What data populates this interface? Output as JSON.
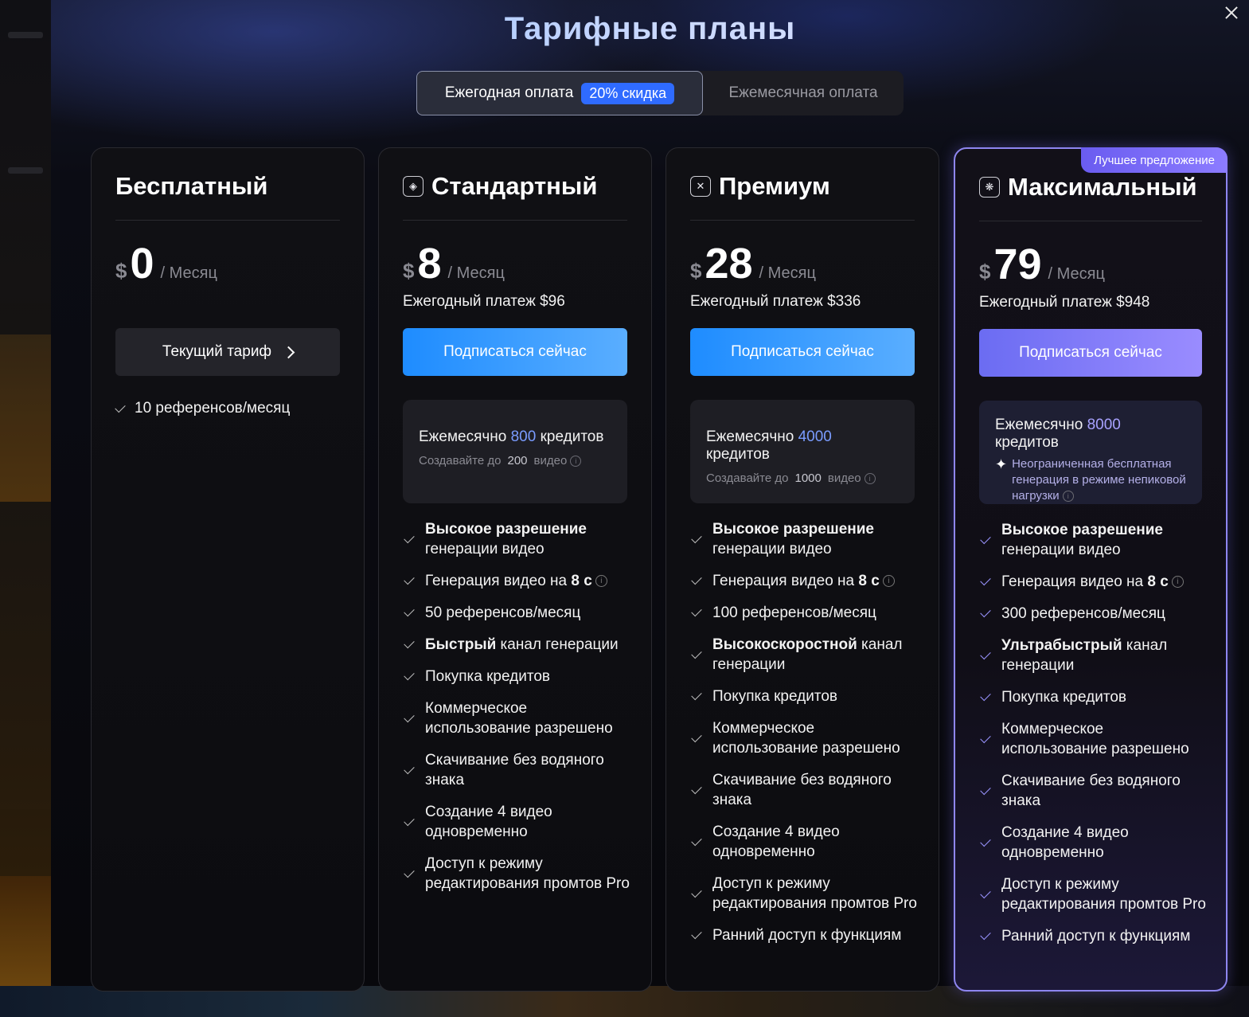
{
  "modal": {
    "title": "Тарифные планы",
    "close_icon": "close-icon"
  },
  "billing_toggle": {
    "annual_label": "Ежегодная оплата",
    "annual_badge": "20% скидка",
    "monthly_label": "Ежемесячная оплата",
    "selected": "annual"
  },
  "plans": {
    "free": {
      "name": "Бесплатный",
      "currency": "$",
      "amount": "0",
      "period": "/ Месяц",
      "button_label": "Текущий тариф",
      "feature": "10 референсов/месяц"
    },
    "standard": {
      "name": "Стандартный",
      "currency": "$",
      "amount": "8",
      "period": "/ Месяц",
      "yearly": "Ежегодный платеж $96",
      "button_label": "Подписаться сейчас",
      "credits_prefix": "Ежемесячно ",
      "credits_num": "800",
      "credits_suffix": " кредитов",
      "sub_prefix": "Создавайте до",
      "sub_num": "200",
      "sub_suffix": "видео",
      "features": [
        {
          "bold": "Высокое разрешение",
          "text": " генерации видео"
        },
        {
          "text": "Генерация видео на ",
          "bold2": "8 с",
          "info": true
        },
        {
          "text": "50 референсов/месяц"
        },
        {
          "bold": "Быстрый",
          "text": " канал генерации"
        },
        {
          "text": "Покупка кредитов"
        },
        {
          "text": "Коммерческое использование разрешено"
        },
        {
          "text": "Скачивание без водяного знака"
        },
        {
          "text": "Создание 4 видео одновременно"
        },
        {
          "text": "Доступ к режиму редактирования промтов Pro"
        }
      ]
    },
    "premium": {
      "name": "Премиум",
      "currency": "$",
      "amount": "28",
      "period": "/ Месяц",
      "yearly": "Ежегодный платеж $336",
      "button_label": "Подписаться сейчас",
      "credits_prefix": "Ежемесячно ",
      "credits_num": "4000",
      "credits_suffix": " кредитов",
      "sub_prefix": "Создавайте до",
      "sub_num": "1000",
      "sub_suffix": "видео",
      "features": [
        {
          "bold": "Высокое разрешение",
          "text": " генерации видео"
        },
        {
          "text": "Генерация видео на ",
          "bold2": "8 с",
          "info": true
        },
        {
          "text": "100 референсов/месяц"
        },
        {
          "bold": "Высокоскоростной",
          "text": " канал генерации"
        },
        {
          "text": "Покупка кредитов"
        },
        {
          "text": "Коммерческое использование разрешено"
        },
        {
          "text": "Скачивание без водяного знака"
        },
        {
          "text": "Создание 4 видео одновременно"
        },
        {
          "text": "Доступ к режиму редактирования промтов Pro"
        },
        {
          "text": "Ранний доступ к функциям"
        }
      ]
    },
    "max": {
      "badge": "Лучшее предложение",
      "name": "Максимальный",
      "currency": "$",
      "amount": "79",
      "period": "/ Месяц",
      "yearly": "Ежегодный платеж $948",
      "button_label": "Подписаться сейчас",
      "credits_prefix": "Ежемесячно ",
      "credits_num": "8000",
      "credits_suffix": " кредитов",
      "unlimited": "Неограниченная бесплатная генерация в режиме непиковой нагрузки",
      "features": [
        {
          "bold": "Высокое разрешение",
          "text": " генерации видео"
        },
        {
          "text": "Генерация видео на ",
          "bold2": "8 с",
          "info": true
        },
        {
          "text": "300 референсов/месяц"
        },
        {
          "bold": "Ультрабыстрый",
          "text": " канал генерации"
        },
        {
          "text": "Покупка кредитов"
        },
        {
          "text": "Коммерческое использование разрешено"
        },
        {
          "text": "Скачивание без водяного знака"
        },
        {
          "text": "Создание 4 видео одновременно"
        },
        {
          "text": "Доступ к режиму редактирования промтов Pro"
        },
        {
          "text": "Ранний доступ к функциям"
        }
      ]
    }
  }
}
